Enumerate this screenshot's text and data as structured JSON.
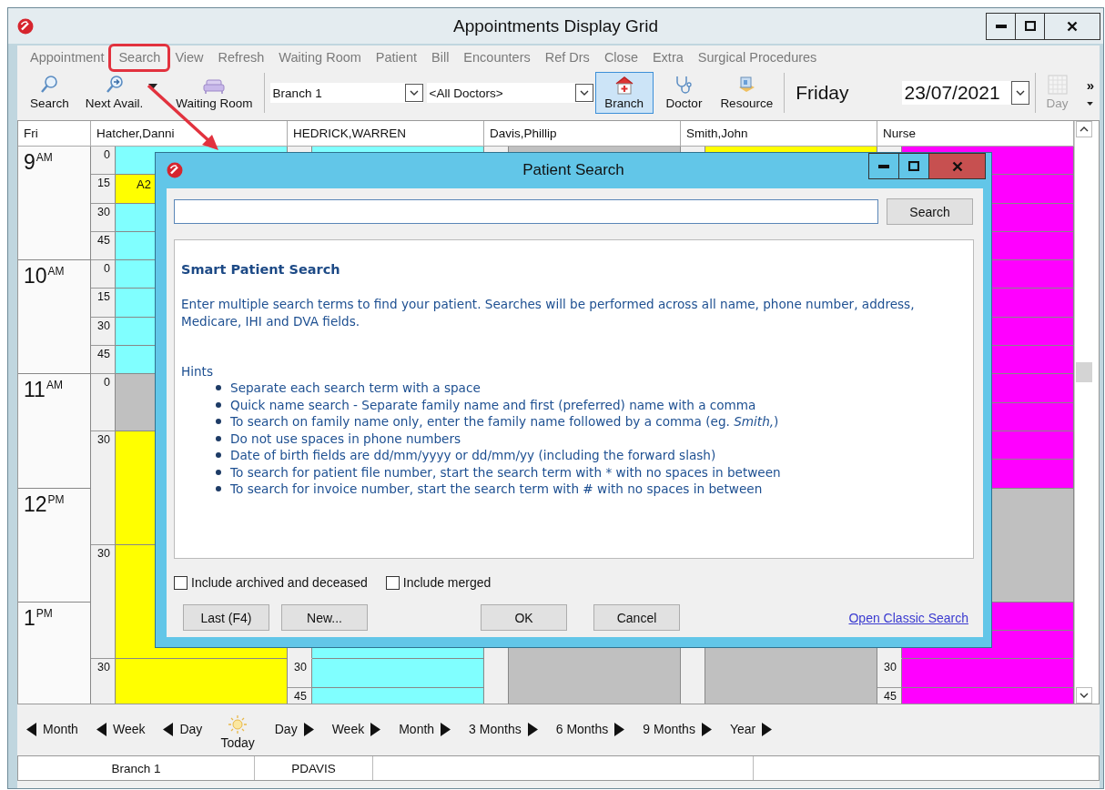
{
  "window": {
    "title": "Appointments Display Grid"
  },
  "menu": [
    {
      "label": "Appointment",
      "highlighted": false
    },
    {
      "label": "Search",
      "highlighted": true
    },
    {
      "label": "View",
      "highlighted": false
    },
    {
      "label": "Refresh",
      "highlighted": false
    },
    {
      "label": "Waiting Room",
      "highlighted": false
    },
    {
      "label": "Patient",
      "highlighted": false
    },
    {
      "label": "Bill",
      "highlighted": false
    },
    {
      "label": "Encounters",
      "highlighted": false
    },
    {
      "label": "Ref Drs",
      "highlighted": false
    },
    {
      "label": "Close",
      "highlighted": false
    },
    {
      "label": "Extra",
      "highlighted": false
    },
    {
      "label": "Surgical Procedures",
      "highlighted": false
    }
  ],
  "toolbar": {
    "actions": [
      {
        "label": "Search",
        "kind": "search"
      },
      {
        "label": "Next Avail.",
        "kind": "next"
      },
      {
        "label": "Waiting Room",
        "kind": "room"
      }
    ],
    "branch_select": {
      "value": "Branch 1"
    },
    "doctor_select": {
      "value": "<All Doctors>"
    },
    "view_buttons": [
      {
        "label": "Branch",
        "kind": "branch",
        "selected": true
      },
      {
        "label": "Doctor",
        "kind": "doctor",
        "selected": false
      },
      {
        "label": "Resource",
        "kind": "resource",
        "selected": false
      }
    ],
    "day_name": "Friday",
    "date_select": {
      "value": "23/07/2021"
    },
    "day_button": {
      "label": "Day",
      "disabled": true
    },
    "overflow": "»"
  },
  "grid": {
    "corner": "Fri",
    "hours": [
      {
        "hour": "9",
        "suffix": "AM"
      },
      {
        "hour": "10",
        "suffix": "AM"
      },
      {
        "hour": "11",
        "suffix": "AM"
      },
      {
        "hour": "12",
        "suffix": "PM"
      },
      {
        "hour": "1",
        "suffix": "PM"
      }
    ],
    "columns": [
      {
        "name": "Hatcher,Danni",
        "slots": [
          {
            "kind": "quarter",
            "label": "0",
            "color": "#80ffff"
          },
          {
            "kind": "quarter",
            "label": "15",
            "color": "#ffff00",
            "text": "A2"
          },
          {
            "kind": "quarter",
            "label": "30",
            "color": "#80ffff"
          },
          {
            "kind": "quarter",
            "label": "45",
            "color": "#80ffff"
          },
          {
            "kind": "quarter",
            "label": "0",
            "color": "#80ffff"
          },
          {
            "kind": "quarter",
            "label": "15",
            "color": "#80ffff"
          },
          {
            "kind": "quarter",
            "label": "30",
            "color": "#80ffff"
          },
          {
            "kind": "quarter",
            "label": "45",
            "color": "#80ffff"
          },
          {
            "kind": "half",
            "label": "0",
            "color": "#c0c0c0"
          },
          {
            "kind": "hour",
            "label": "30",
            "color": "#ffff00"
          },
          {
            "kind": "hour",
            "label": "30",
            "color": "#ffff00"
          },
          {
            "kind": "half",
            "label": "30",
            "color": "#ffff00"
          }
        ]
      },
      {
        "name": "HEDRICK,WARREN",
        "slots": [
          {
            "kind": "hour",
            "color": "#80ffff"
          },
          {
            "kind": "hour"
          },
          {
            "kind": "hour"
          },
          {
            "kind": "hour"
          },
          {
            "kind": "half",
            "color": "#80ffff"
          },
          {
            "kind": "quarter",
            "label": "30",
            "color": "#80ffff"
          },
          {
            "kind": "quarter",
            "label": "45",
            "color": "#80ffff"
          }
        ]
      },
      {
        "name": "Davis,Phillip",
        "slots": [
          {
            "kind": "hour",
            "color": "#c0c0c0"
          },
          {
            "kind": "hour"
          },
          {
            "kind": "hour"
          },
          {
            "kind": "hour"
          },
          {
            "kind": "hour",
            "color": "#c0c0c0"
          }
        ]
      },
      {
        "name": "Smith,John",
        "slots": [
          {
            "kind": "hour",
            "color": "#ffff00"
          },
          {
            "kind": "hour"
          },
          {
            "kind": "hour"
          },
          {
            "kind": "hour"
          },
          {
            "kind": "hour",
            "color": "#c0c0c0"
          }
        ]
      },
      {
        "name": "Nurse",
        "slots": [
          {
            "kind": "quarter",
            "color": "#ff00ff"
          },
          {
            "kind": "quarter",
            "color": "#ff00ff"
          },
          {
            "kind": "quarter",
            "color": "#ff00ff"
          },
          {
            "kind": "quarter",
            "color": "#ff00ff"
          },
          {
            "kind": "quarter",
            "color": "#ff00ff"
          },
          {
            "kind": "quarter",
            "color": "#ff00ff"
          },
          {
            "kind": "quarter",
            "color": "#ff00ff"
          },
          {
            "kind": "quarter",
            "color": "#ff00ff"
          },
          {
            "kind": "quarter",
            "color": "#ff00ff"
          },
          {
            "kind": "quarter",
            "color": "#ff00ff"
          },
          {
            "kind": "quarter",
            "color": "#ff00ff"
          },
          {
            "kind": "quarter",
            "color": "#ff00ff"
          },
          {
            "kind": "hour",
            "color": "#c0c0c0"
          },
          {
            "kind": "quarter",
            "color": "#ff00ff"
          },
          {
            "kind": "quarter",
            "color": "#ff00ff"
          },
          {
            "kind": "quarter",
            "label": "30",
            "color": "#ff00ff"
          },
          {
            "kind": "quarter",
            "label": "45",
            "color": "#ff00ff"
          }
        ]
      }
    ]
  },
  "navigation": [
    {
      "label": "Month",
      "kind": "prev"
    },
    {
      "label": "Week",
      "kind": "prev"
    },
    {
      "label": "Day",
      "kind": "prev"
    },
    {
      "label": "Today",
      "kind": "today"
    },
    {
      "label": "Day",
      "kind": "next"
    },
    {
      "label": "Week",
      "kind": "next"
    },
    {
      "label": "Month",
      "kind": "next"
    },
    {
      "label": "3 Months",
      "kind": "next"
    },
    {
      "label": "6 Months",
      "kind": "next"
    },
    {
      "label": "9 Months",
      "kind": "next"
    },
    {
      "label": "Year",
      "kind": "next"
    }
  ],
  "status_bar": [
    {
      "text": "Branch 1"
    },
    {
      "text": "PDAVIS"
    }
  ],
  "dialog": {
    "title": "Patient Search",
    "search_button": "Search",
    "heading": "Smart Patient Search",
    "description": "Enter multiple search terms to find your patient. Searches will be performed across all name, phone number, address, Medicare, IHI and DVA fields.",
    "hints_title": "Hints",
    "hints": [
      "Separate each search term with a space",
      "Quick name search - Separate family name and first (preferred) name with a comma",
      "To search on family name only, enter the family name followed by a comma (eg. *Smith,*)",
      "Do not use spaces in phone numbers",
      "Date of birth fields are dd/mm/yyyy or dd/mm/yy (including the forward slash)",
      "To search for patient file number, start the search term with * with no spaces in between",
      "To search for invoice number, start the search term with # with no spaces in between"
    ],
    "options": [
      {
        "label": "Include archived and deceased",
        "checked": false
      },
      {
        "label": "Include merged",
        "checked": false
      }
    ],
    "buttons": [
      {
        "label": "Last (F4)"
      },
      {
        "label": "New..."
      },
      {
        "label": "OK"
      },
      {
        "label": "Cancel"
      }
    ],
    "link": "Open Classic Search"
  }
}
